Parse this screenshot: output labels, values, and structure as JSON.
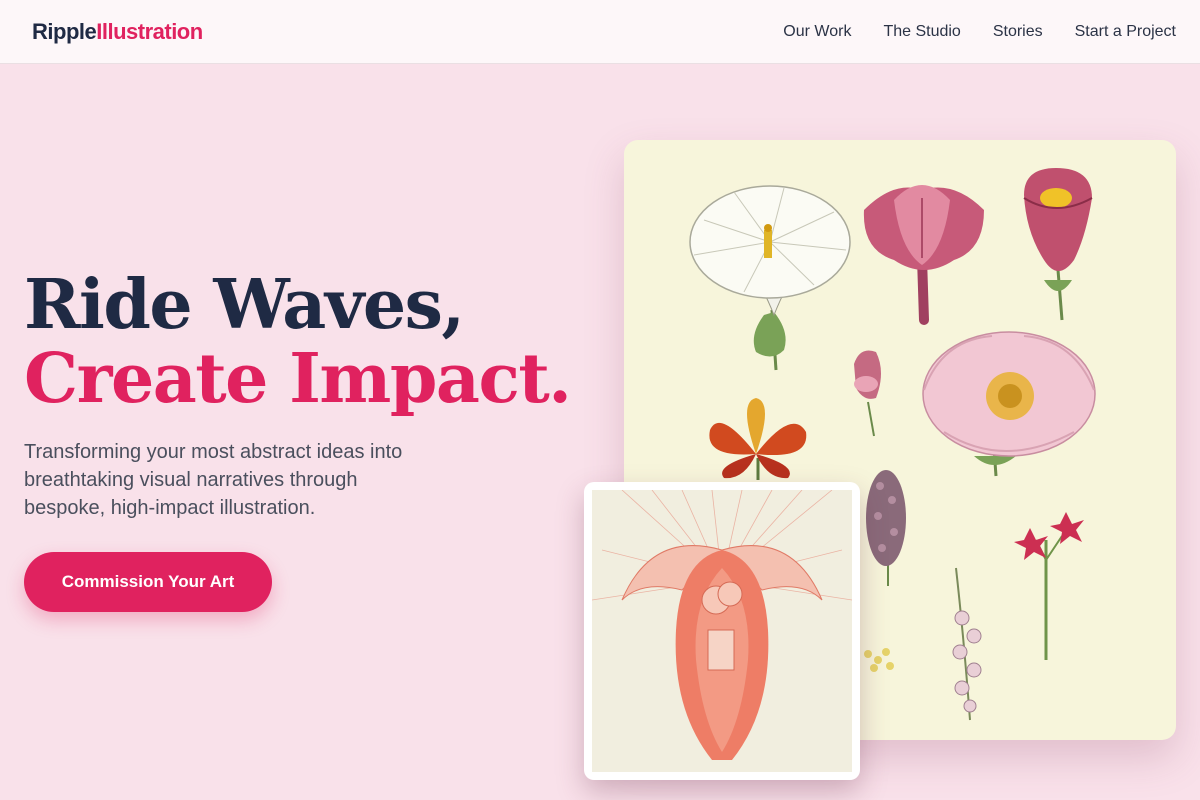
{
  "brand": {
    "part1": "Ripple",
    "part2": "Illustration"
  },
  "nav": {
    "items": [
      "Our Work",
      "The Studio",
      "Stories",
      "Start a Project"
    ]
  },
  "hero": {
    "title_line1": "Ride Waves,",
    "title_line2": "Create Impact.",
    "subtitle": "Transforming your most abstract ideas into breathtaking visual narratives through bespoke, high-impact illustration.",
    "cta_label": "Commission Your Art"
  },
  "colors": {
    "background": "#f9e1ea",
    "navy": "#1f2a44",
    "accent": "#e0225f",
    "botanical_paper": "#f7f5db"
  }
}
